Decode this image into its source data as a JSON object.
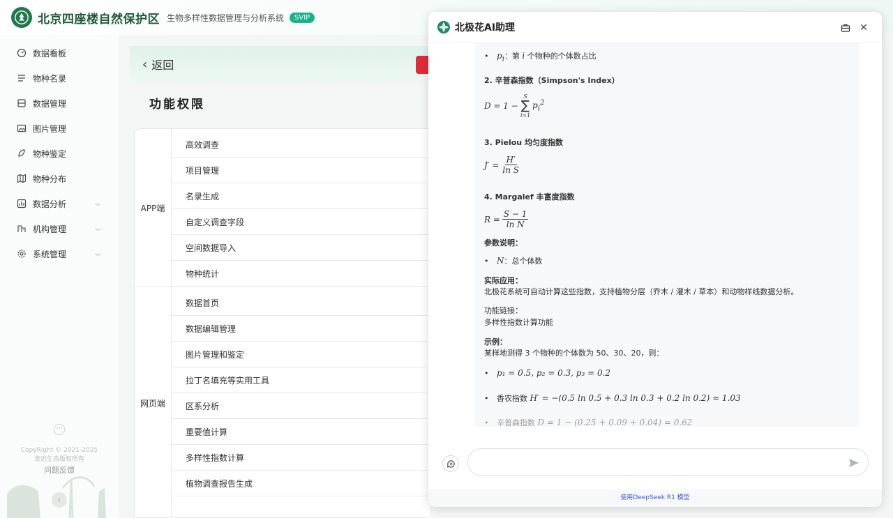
{
  "header": {
    "brand": "北京四座楼自然保护区",
    "subtitle": "生物多样性数据管理与分析系统",
    "badge": "SVIP"
  },
  "sidebar": {
    "items": [
      {
        "label": "数据看板",
        "icon": "dashboard-icon",
        "expandable": false
      },
      {
        "label": "物种名录",
        "icon": "list-icon",
        "expandable": false
      },
      {
        "label": "数据管理",
        "icon": "database-icon",
        "expandable": false
      },
      {
        "label": "图片管理",
        "icon": "image-icon",
        "expandable": false
      },
      {
        "label": "物种鉴定",
        "icon": "identify-icon",
        "expandable": false
      },
      {
        "label": "物种分布",
        "icon": "map-icon",
        "expandable": false
      },
      {
        "label": "数据分析",
        "icon": "chart-icon",
        "expandable": true
      },
      {
        "label": "机构管理",
        "icon": "org-icon",
        "expandable": true
      },
      {
        "label": "系统管理",
        "icon": "gear-icon",
        "expandable": true
      }
    ],
    "dots": "···",
    "copyright": "CopyRight © 2021-2025",
    "rights": "青远生态版权所有",
    "feedback": "问题反馈",
    "collapse": "‹"
  },
  "main": {
    "back_label": "返回",
    "section_title": "功能权限",
    "groups": [
      {
        "label": "APP端",
        "rows": [
          "高效调查",
          "项目管理",
          "名录生成",
          "自定义调查字段",
          "空间数据导入",
          "物种统计"
        ]
      },
      {
        "label": "网页端",
        "rows": [
          "数据首页",
          "数据编辑管理",
          "图片管理和鉴定",
          "拉丁名填充等实用工具",
          "区系分析",
          "重要值计算",
          "多样性指数计算",
          "植物调查报告生成"
        ]
      }
    ]
  },
  "chat": {
    "title": "北极花AI助理",
    "p_i_label": "：第",
    "p_i_sym": "i",
    "p_i_rest": "个物种的个体数占比",
    "simpson_heading": "2. 辛普森指数（Simpson's Index）",
    "simpson_formula_lhs": "D = 1 −",
    "simpson_sum_top": "S",
    "simpson_sum_bot": "i=1",
    "simpson_term": "p",
    "pielou_heading_a": "3. Pielou ",
    "pielou_heading_b": "均匀度指数",
    "pielou_lhs": "J′ =",
    "pielou_num": "H′",
    "pielou_den": "ln S",
    "margalef_heading_a": "4. Margalef ",
    "margalef_heading_b": "丰富度指数",
    "margalef_lhs": "R =",
    "margalef_num": "S − 1",
    "margalef_den": "ln N",
    "params_heading": "参数说明",
    "param_n_sym": "N",
    "param_n_desc": "：总个体数",
    "practice_heading": "实际应用",
    "practice_text": "北极花系统可自动计算这些指数，支持植物分层（乔木 / 灌木 / 草本）和动物样线数据分析。",
    "link_heading": "功能链接：",
    "link_text": "多样性指数计算功能",
    "example_heading": "示例",
    "example_text": "某样地测得 3 个物种的个体数为 50、30、20，则：",
    "example_b1": "p₁ = 0.5, p₂ = 0.3, p₃ = 0.2",
    "example_b2_label": "香农指数",
    "example_b2_formula": "H′ = −(0.5 ln 0.5 + 0.3 ln 0.3 + 0.2 ln 0.2) ≈ 1.03",
    "example_b3_label": "辛普森指数",
    "example_b3_formula": "D = 1 − (0.25 + 0.09 + 0.04) = 0.62",
    "input_placeholder": "",
    "footer": "使用DeepSeek R1 模型"
  }
}
